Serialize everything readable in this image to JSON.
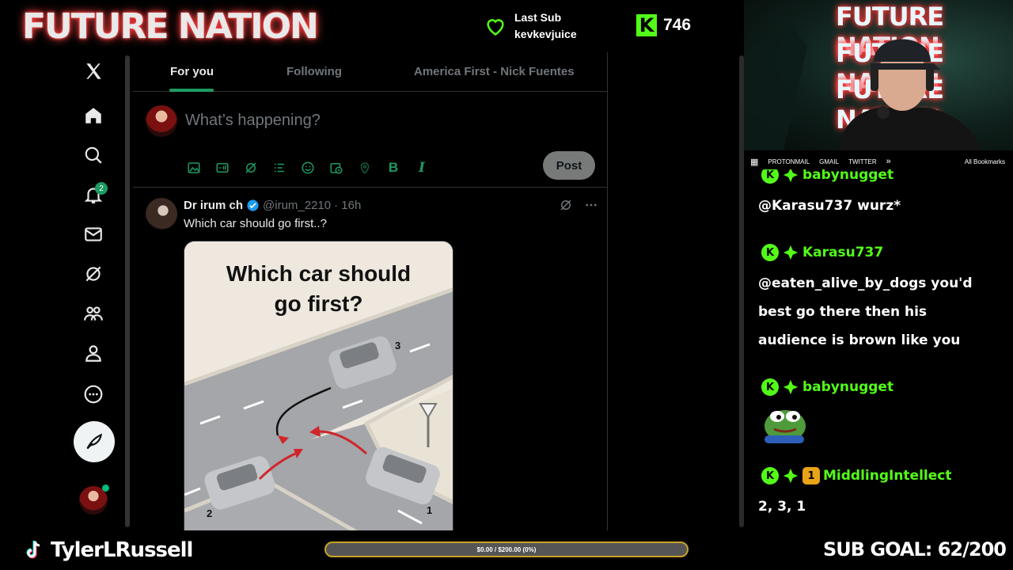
{
  "overlay": {
    "brand": "FUTURE NATION",
    "last_sub_label": "Last Sub",
    "last_sub_name": "kevkevjuice",
    "kick_letter": "K",
    "kick_count": "746"
  },
  "x": {
    "nav": {
      "notifications_badge": "2"
    },
    "tabs": [
      {
        "label": "For you",
        "active": true
      },
      {
        "label": "Following",
        "active": false
      },
      {
        "label": "America First - Nick Fuentes",
        "active": false
      }
    ],
    "composer": {
      "placeholder": "What’s happening?",
      "post_label": "Post",
      "bold_label": "B",
      "italic_label": "I"
    },
    "tweet": {
      "name": "Dr irum ch",
      "handle": "@irum_2210",
      "time": "· 16h",
      "text": "Which car should go first..?",
      "media_title_line1": "Which car should",
      "media_title_line2": "go first?",
      "car_labels": [
        "3",
        "2",
        "1"
      ]
    },
    "accent_color": "#1d9b62"
  },
  "cam": {
    "neon_lines": [
      "FUTURE NATION",
      "FUTURE NATION",
      "FUTURE NATION"
    ]
  },
  "bookmarks": {
    "items": [
      "PROTONMAIL",
      "GMAIL",
      "TWITTER"
    ],
    "more": "»",
    "all": "All Bookmarks"
  },
  "chat": {
    "messages": [
      {
        "user": "babynugget",
        "text": "@Karasu737 wurz*"
      },
      {
        "user": "Karasu737",
        "text": "@eaten_alive_by_dogs you'd best go there then his audience is brown like you"
      },
      {
        "user": "babynugget",
        "text": ""
      },
      {
        "user": "MiddlingIntellect",
        "badge": "1",
        "text": "2, 3, 1"
      }
    ],
    "kick_badge": "K"
  },
  "bottom": {
    "handle": "TylerLRussell",
    "goal_text": "$0.00 / $200.00 (0%)",
    "goal_progress": 0,
    "sub_goal": "SUB GOAL: 62/200"
  }
}
